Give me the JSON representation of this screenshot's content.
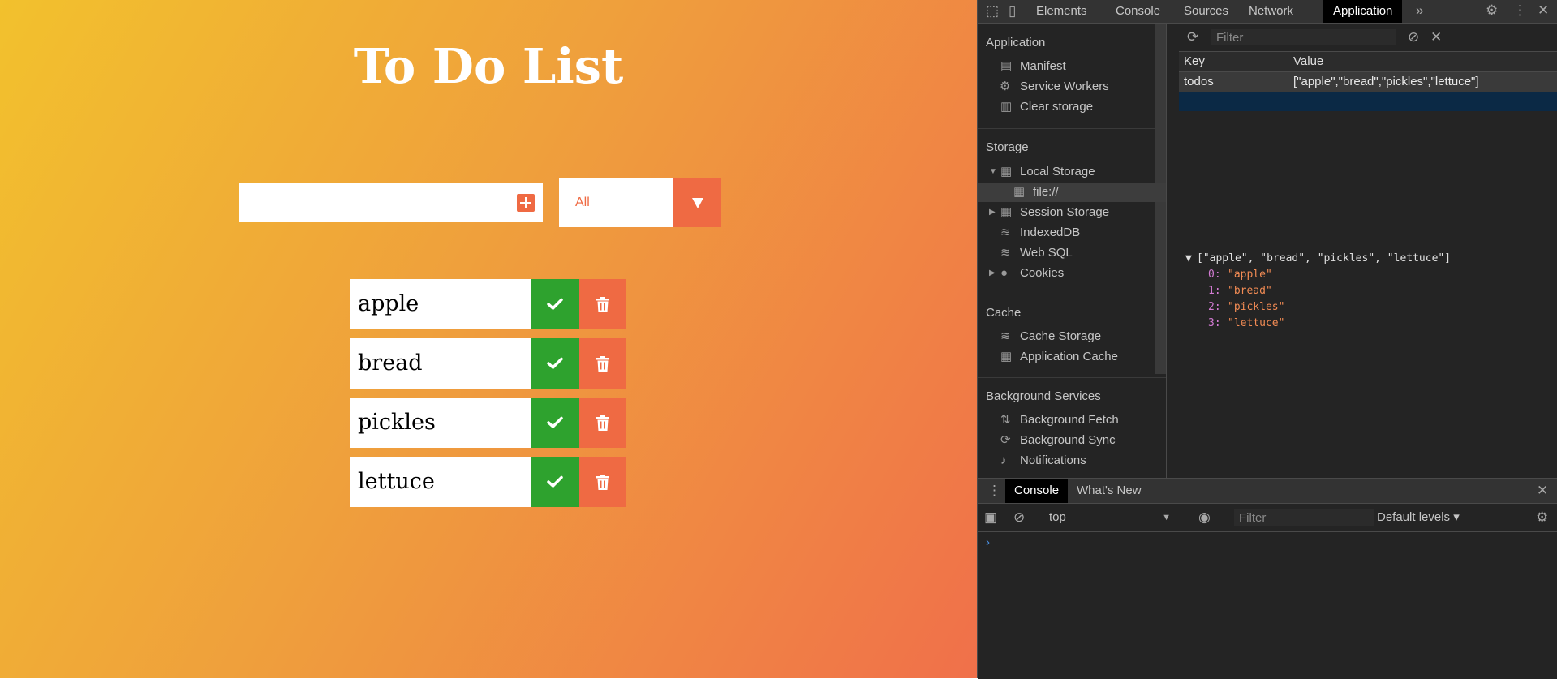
{
  "app": {
    "title": "To Do List",
    "todo_input": {
      "value": "",
      "placeholder": ""
    },
    "add_icon": "plus-square-icon",
    "filter_select": {
      "value": "All"
    },
    "todos": [
      {
        "text": "apple"
      },
      {
        "text": "bread"
      },
      {
        "text": "pickles"
      },
      {
        "text": "lettuce"
      }
    ],
    "colors": {
      "accent": "#ef6a43",
      "complete": "#2ea22e",
      "gradient_start": "#f2c12d",
      "gradient_end": "#f0704a"
    }
  },
  "devtools": {
    "tabs": [
      "Elements",
      "Console",
      "Sources",
      "Network",
      "Application"
    ],
    "active_tab": "Application",
    "more_tabs": "»",
    "sidebar": {
      "application": {
        "header": "Application",
        "items": [
          "Manifest",
          "Service Workers",
          "Clear storage"
        ]
      },
      "storage": {
        "header": "Storage",
        "local_storage": "Local Storage",
        "local_origin": "file://",
        "session_storage": "Session Storage",
        "indexeddb": "IndexedDB",
        "websql": "Web SQL",
        "cookies": "Cookies"
      },
      "cache": {
        "header": "Cache",
        "items": [
          "Cache Storage",
          "Application Cache"
        ]
      },
      "background": {
        "header": "Background Services",
        "items": [
          "Background Fetch",
          "Background Sync",
          "Notifications"
        ]
      }
    },
    "storage_view": {
      "filter_placeholder": "Filter",
      "columns": {
        "key": "Key",
        "value": "Value"
      },
      "rows": [
        {
          "key": "todos",
          "value": "[\"apple\",\"bread\",\"pickles\",\"lettuce\"]"
        }
      ],
      "preview": {
        "summary": "[\"apple\", \"bread\", \"pickles\", \"lettuce\"]",
        "entries": [
          {
            "index": "0:",
            "value": "\"apple\""
          },
          {
            "index": "1:",
            "value": "\"bread\""
          },
          {
            "index": "2:",
            "value": "\"pickles\""
          },
          {
            "index": "3:",
            "value": "\"lettuce\""
          }
        ]
      }
    },
    "drawer": {
      "tabs": [
        "Console",
        "What's New"
      ],
      "active_tab": "Console",
      "context": "top",
      "filter_placeholder": "Filter",
      "levels": "Default levels ▾",
      "prompt": "›"
    }
  }
}
